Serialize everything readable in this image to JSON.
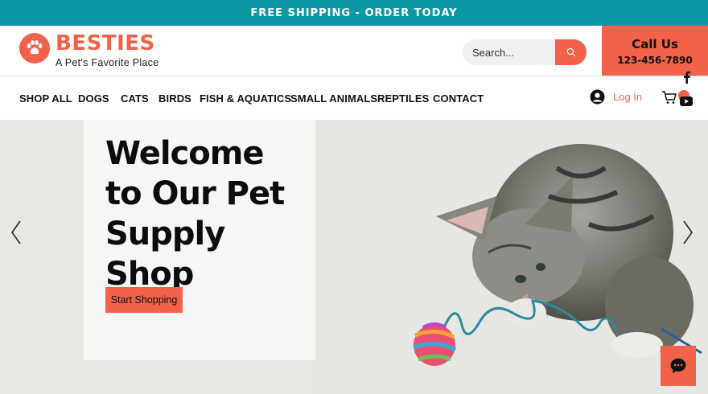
{
  "banner": {
    "text": "FREE SHIPPING - ORDER TODAY"
  },
  "header": {
    "brand": "BESTIES",
    "tagline": "A Pet's Favorite Place",
    "search_placeholder": "Search...",
    "call_title": "Call Us",
    "call_number": "123-456-7890"
  },
  "nav": {
    "items": [
      "SHOP ALL",
      "DOGS",
      "CATS",
      "BIRDS",
      "FISH & AQUATICS",
      "SMALL ANIMALS",
      "REPTILES",
      "CONTACT"
    ],
    "login": "Log In"
  },
  "social": [
    "facebook-icon",
    "youtube-icon",
    "instagram-icon"
  ],
  "hero": {
    "title": "Welcome\nto Our Pet\nSupply Shop",
    "cta": "Start Shopping"
  },
  "colors": {
    "accent": "#f2624a",
    "banner": "#0b98a3"
  }
}
